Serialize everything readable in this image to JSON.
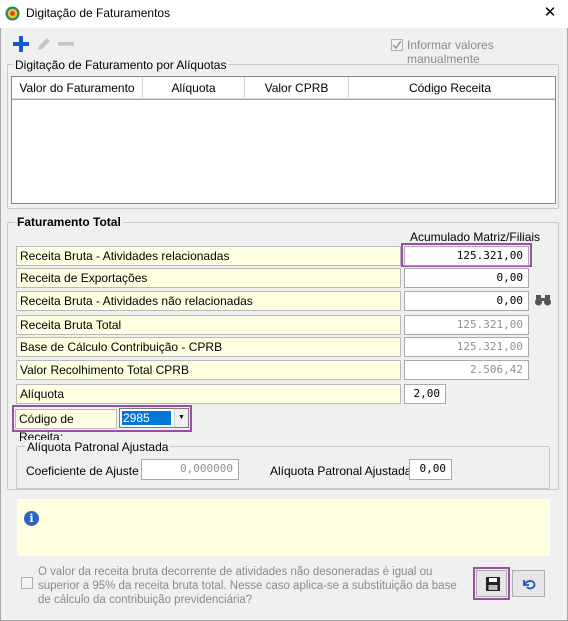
{
  "window": {
    "title": "Digitação de Faturamentos",
    "close": "✕"
  },
  "toolbar": {
    "add_symbol": "+",
    "edit_symbol": "✎",
    "remove_symbol": "—",
    "manual_values_label": "Informar valores manualmente",
    "manual_checked": true
  },
  "aliquotas": {
    "title": "Digitação de Faturamento por Alíquotas",
    "columns": [
      "Valor do Faturamento",
      "Alíquota",
      "Valor CPRB",
      "Código Receita"
    ]
  },
  "faturamento": {
    "title": "Faturamento Total",
    "column_header": "Acumulado Matriz/Filiais",
    "rows": [
      {
        "label": "Receita Bruta - Atividades relacionadas",
        "value": "125.321,00"
      },
      {
        "label": "Receita de Exportações",
        "value": "0,00"
      },
      {
        "label": "Receita Bruta - Atividades não relacionadas",
        "value": "0,00"
      },
      {
        "label": "Receita Bruta Total",
        "value": "125.321,00"
      },
      {
        "label": "Base de Cálculo Contribuição - CPRB",
        "value": "125.321,00"
      },
      {
        "label": "Valor Recolhimento Total CPRB",
        "value": "2.506,42"
      }
    ],
    "aliquota_label": "Alíquota",
    "aliquota_value": "2,00",
    "codigo_label": "Código de Receita:",
    "codigo_value": "2985"
  },
  "patronal": {
    "title": "Alíquota Patronal Ajustada",
    "coef_label": "Coeficiente de Ajuste",
    "coef_value": "0,000000",
    "aliq_label": "Alíquota Patronal Ajustada",
    "aliq_value": "0,00"
  },
  "info": {
    "icon_letter": "i"
  },
  "note": {
    "text": "O valor da receita bruta decorrente de atividades não desoneradas é igual ou superior a 95% da receita bruta total. Nesse caso aplica-se a substituição da base de cálculo da contribuição previdenciária?"
  },
  "colors": {
    "accent": "#1a57c9",
    "highlight": "#9b4ea8",
    "label_bg": "#ffffe1"
  }
}
